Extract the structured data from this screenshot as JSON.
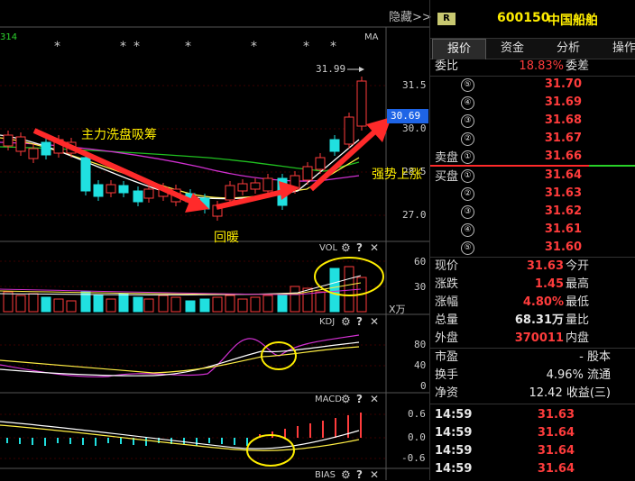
{
  "header": {
    "hide_label": "隐藏>>",
    "top_left_code": "314",
    "ma_label": "MA"
  },
  "stock": {
    "badge": "R",
    "code": "600150",
    "name": "中国船舶"
  },
  "tabs": [
    "报价",
    "资金",
    "分析",
    "操作"
  ],
  "main_chart": {
    "price_marker": "31.99",
    "current_price_tag": "30.69",
    "y_ticks": [
      "31.5",
      "30.0",
      "28.5",
      "27.0"
    ],
    "annotations": {
      "washout": "主力洗盘吸筹",
      "recover": "回暖",
      "strong": "强势上涨"
    },
    "accent_red": "#ff2a2a",
    "marker_blue": "#1e64e6",
    "highlight_yellow": "#ffee00"
  },
  "vol_panel": {
    "label": "VOL",
    "y_ticks": [
      "60",
      "30"
    ],
    "unit": "X万"
  },
  "kdj_panel": {
    "label": "KDJ",
    "y_ticks": [
      "80",
      "40",
      "0"
    ]
  },
  "macd_panel": {
    "label": "MACD",
    "y_ticks": [
      "0.6",
      "0.0",
      "-0.6"
    ]
  },
  "bias_panel": {
    "label": "BIAS"
  },
  "panel_icons": [
    "gear-icon",
    "question-icon",
    "close-icon"
  ],
  "quote": {
    "weibi_label": "委比",
    "weibi": "18.83%",
    "weicha_label": "委差",
    "sell_label": "卖盘",
    "buy_label": "买盘",
    "sell": [
      {
        "n": "⑤",
        "price": "31.70"
      },
      {
        "n": "④",
        "price": "31.69"
      },
      {
        "n": "③",
        "price": "31.68"
      },
      {
        "n": "②",
        "price": "31.67"
      },
      {
        "n": "①",
        "price": "31.66"
      }
    ],
    "buy": [
      {
        "n": "①",
        "price": "31.64"
      },
      {
        "n": "②",
        "price": "31.63"
      },
      {
        "n": "③",
        "price": "31.62"
      },
      {
        "n": "④",
        "price": "31.61"
      },
      {
        "n": "⑤",
        "price": "31.60"
      }
    ],
    "stats": [
      {
        "l": "现价",
        "v": "31.63",
        "r": "今开",
        "color": "red"
      },
      {
        "l": "涨跌",
        "v": "1.45",
        "r": "最高",
        "color": "red"
      },
      {
        "l": "涨幅",
        "v": "4.80%",
        "r": "最低",
        "color": "red"
      },
      {
        "l": "总量",
        "v": "68.31万",
        "r": "量比",
        "color": "white"
      },
      {
        "l": "外盘",
        "v": "370011",
        "r": "内盘",
        "color": "red"
      }
    ],
    "stats2": [
      {
        "l": "市盈",
        "v": "- 股本",
        "color": "white"
      },
      {
        "l": "换手",
        "v": "4.96% 流通",
        "color": "white"
      },
      {
        "l": "净资",
        "v": "12.42 收益(三)",
        "color": "white"
      }
    ],
    "ticks": [
      {
        "t": "14:59",
        "p": "31.63"
      },
      {
        "t": "14:59",
        "p": "31.64"
      },
      {
        "t": "14:59",
        "p": "31.64"
      },
      {
        "t": "14:59",
        "p": "31.64"
      }
    ]
  }
}
